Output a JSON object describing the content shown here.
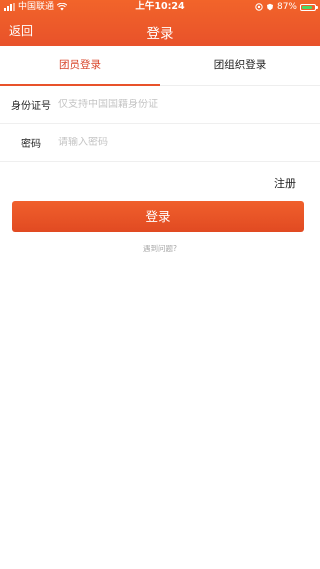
{
  "statusbar": {
    "carrier": "中国联通",
    "time": "上午10:24",
    "battery": "87%",
    "battery_level": 0.87,
    "battery_color": "#4cd964"
  },
  "navbar": {
    "back_label": "返回",
    "title": "登录",
    "background_color": "#e8522a"
  },
  "tabs": [
    {
      "label": "团员登录",
      "active": true
    },
    {
      "label": "团组织登录",
      "active": false
    }
  ],
  "form": {
    "id_field": {
      "label": "身份证号",
      "placeholder": "仅支持中国国籍身份证",
      "value": ""
    },
    "password_field": {
      "label": "密码",
      "placeholder": "请输入密码",
      "value": ""
    }
  },
  "register_label": "注册",
  "login_button_label": "登录",
  "help_link_label": "遇到问题?",
  "icons": {
    "signal": "signal-icon",
    "wifi": "wifi-icon",
    "location": "location-icon",
    "alarm": "alarm-icon",
    "battery": "battery-icon"
  }
}
